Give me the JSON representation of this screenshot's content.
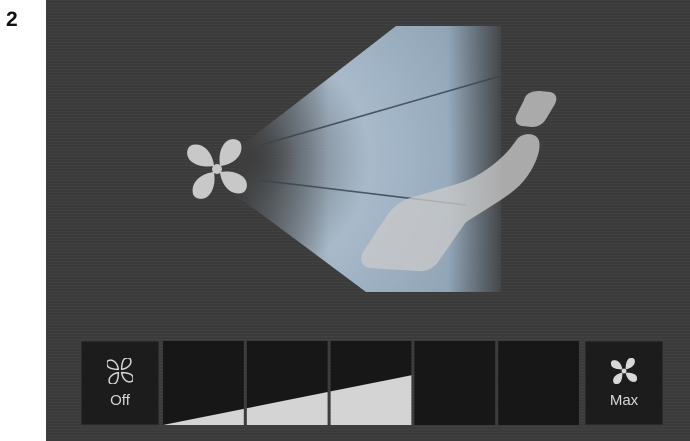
{
  "figure": {
    "number": "2"
  },
  "airflow_diagram": {
    "fan_icon": "fan-icon",
    "seat_icon": "seat-icon",
    "colors": {
      "screen_background": "#3d3d3d",
      "airflow_beam": "#aec3d6",
      "icons": "#c8c8c8"
    }
  },
  "fan_control": {
    "off_button": {
      "icon": "fan-outline-icon",
      "label": "Off"
    },
    "max_button": {
      "icon": "fan-solid-icon",
      "label": "Max"
    },
    "segment_count": 5,
    "level": 0.6,
    "colors": {
      "segment_background": "#171717",
      "level_fill": "#d4d4d4",
      "divider": "#4a4a4a"
    }
  }
}
